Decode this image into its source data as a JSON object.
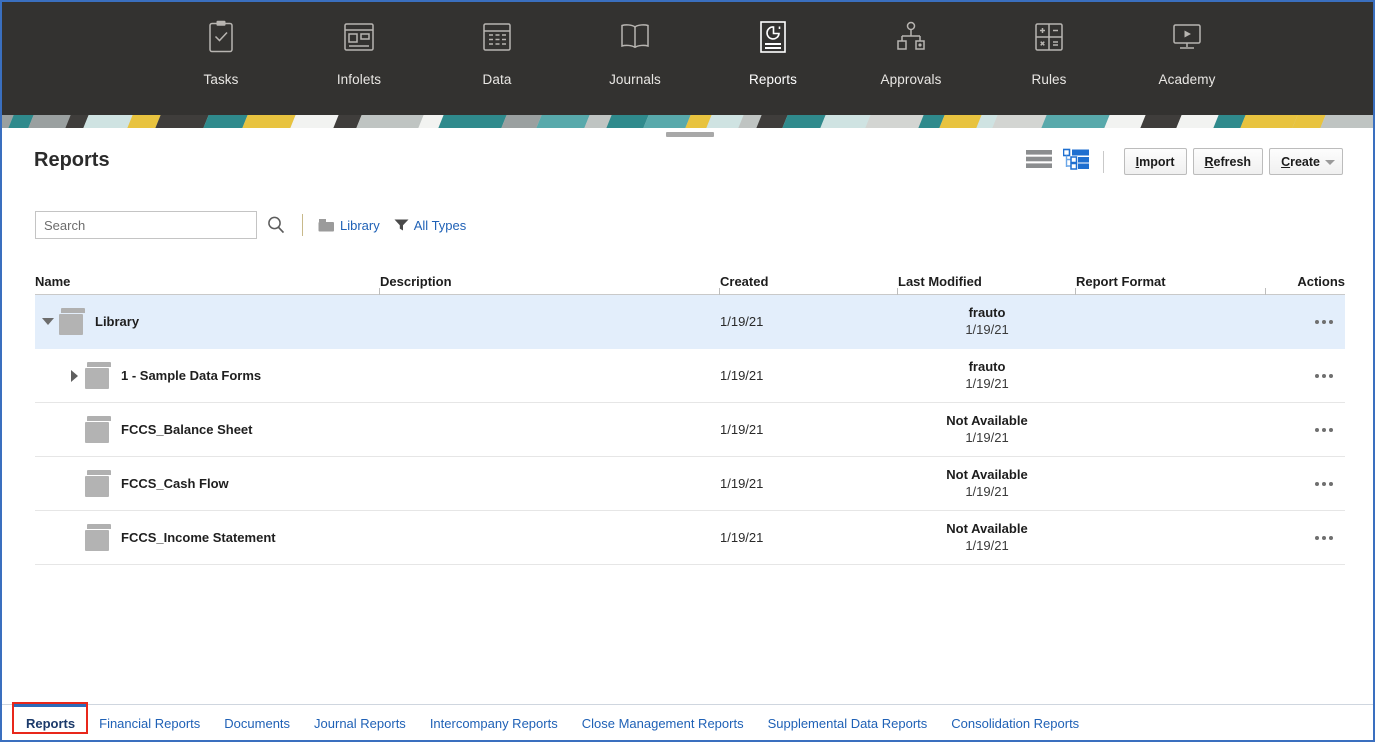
{
  "topnav": {
    "items": [
      {
        "label": "Tasks",
        "icon": "clipboard-check-icon",
        "active": false
      },
      {
        "label": "Infolets",
        "icon": "infolets-panel-icon",
        "active": false
      },
      {
        "label": "Data",
        "icon": "grid-table-icon",
        "active": false
      },
      {
        "label": "Journals",
        "icon": "open-book-icon",
        "active": false
      },
      {
        "label": "Reports",
        "icon": "report-chart-icon",
        "active": true
      },
      {
        "label": "Approvals",
        "icon": "hierarchy-icon",
        "active": false
      },
      {
        "label": "Rules",
        "icon": "calculator-icon",
        "active": false
      },
      {
        "label": "Academy",
        "icon": "video-monitor-icon",
        "active": false
      }
    ]
  },
  "header": {
    "title": "Reports"
  },
  "toolbar": {
    "list_view_icon": "list-view-icon",
    "tree_view_icon": "tree-view-icon",
    "buttons": [
      {
        "accesskey": "I",
        "rest": "mport",
        "label": "Import",
        "caret": false
      },
      {
        "accesskey": "R",
        "rest": "efresh",
        "label": "Refresh",
        "caret": false
      },
      {
        "accesskey": "C",
        "rest": "reate",
        "label": "Create",
        "caret": true
      }
    ]
  },
  "search": {
    "placeholder": "Search",
    "value": "",
    "search_icon": "search-icon",
    "links": [
      {
        "label": "Library",
        "icon": "folder-icon"
      },
      {
        "label": "All Types",
        "icon": "filter-funnel-icon"
      }
    ]
  },
  "table": {
    "columns": [
      "Name",
      "Description",
      "Created",
      "Last Modified",
      "Report Format",
      "Actions"
    ],
    "rows": [
      {
        "name": "Library",
        "description": "",
        "created": "1/19/21",
        "modified_user": "frauto",
        "modified_date": "1/19/21",
        "report_format": "",
        "indent": 0,
        "twisty": "open",
        "selected": true
      },
      {
        "name": "1 - Sample Data Forms",
        "description": "",
        "created": "1/19/21",
        "modified_user": "frauto",
        "modified_date": "1/19/21",
        "report_format": "",
        "indent": 1,
        "twisty": "closed",
        "selected": false
      },
      {
        "name": "FCCS_Balance Sheet",
        "description": "",
        "created": "1/19/21",
        "modified_user": "Not Available",
        "modified_date": "1/19/21",
        "report_format": "",
        "indent": 1,
        "twisty": "none",
        "selected": false
      },
      {
        "name": "FCCS_Cash Flow",
        "description": "",
        "created": "1/19/21",
        "modified_user": "Not Available",
        "modified_date": "1/19/21",
        "report_format": "",
        "indent": 1,
        "twisty": "none",
        "selected": false
      },
      {
        "name": "FCCS_Income Statement",
        "description": "",
        "created": "1/19/21",
        "modified_user": "Not Available",
        "modified_date": "1/19/21",
        "report_format": "",
        "indent": 1,
        "twisty": "none",
        "selected": false
      }
    ],
    "actions_icon": "overflow-menu-icon"
  },
  "tabbar": {
    "tabs": [
      {
        "label": "Reports",
        "active": true
      },
      {
        "label": "Financial Reports",
        "active": false
      },
      {
        "label": "Documents",
        "active": false
      },
      {
        "label": "Journal Reports",
        "active": false
      },
      {
        "label": "Intercompany Reports",
        "active": false
      },
      {
        "label": "Close Management Reports",
        "active": false
      },
      {
        "label": "Supplemental Data Reports",
        "active": false
      },
      {
        "label": "Consolidation Reports",
        "active": false
      }
    ]
  },
  "colors": {
    "nav_background": "#333230",
    "link_blue": "#1f61b6",
    "selected_row": "#e3eefb",
    "annotation_red": "#e8271a",
    "accent_blue": "#2c6ab8"
  },
  "annotation": {
    "type": "highlight-rectangle",
    "target": "Reports"
  }
}
